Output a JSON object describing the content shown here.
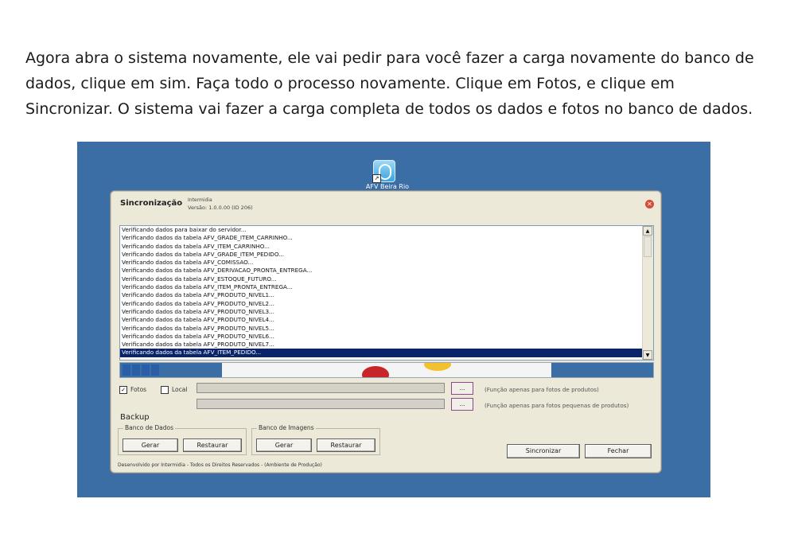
{
  "instructions": {
    "lines": [
      "Agora abra o sistema novamente, ele vai pedir para você fazer a carga novamente do banco de",
      "dados, clique em sim. Faça todo o processo novamente. Clique em Fotos, e clique em",
      "Sincronizar. O sistema vai fazer a carga completa de todos os dados e fotos no banco de dados."
    ]
  },
  "desktop": {
    "icon": "app-shortcut-icon",
    "icon_label": "AFV Beira Rio"
  },
  "dialog": {
    "title": "Sincronização",
    "company": "Intermidia",
    "version": "Versão: 1.0.0.00 (ID 206)",
    "close_icon": "close-icon",
    "log_lines": [
      "Verificando dados para baixar do servidor...",
      "Verificando dados da tabela  AFV_GRADE_ITEM_CARRINHO...",
      "Verificando dados da tabela  AFV_ITEM_CARRINHO...",
      "Verificando dados da tabela  AFV_GRADE_ITEM_PEDIDO...",
      "Verificando dados da tabela  AFV_COMISSAO...",
      "Verificando dados da tabela  AFV_DERIVACAO_PRONTA_ENTREGA...",
      "Verificando dados da tabela  AFV_ESTOQUE_FUTURO...",
      "Verificando dados da tabela  AFV_ITEM_PRONTA_ENTREGA...",
      "Verificando dados da tabela  AFV_PRODUTO_NIVEL1...",
      "Verificando dados da tabela  AFV_PRODUTO_NIVEL2...",
      "Verificando dados da tabela  AFV_PRODUTO_NIVEL3...",
      "Verificando dados da tabela  AFV_PRODUTO_NIVEL4...",
      "Verificando dados da tabela  AFV_PRODUTO_NIVEL5...",
      "Verificando dados da tabela  AFV_PRODUTO_NIVEL6...",
      "Verificando dados da tabela  AFV_PRODUTO_NIVEL7...",
      "Verificando dados da tabela  AFV_ITEM_PEDIDO..."
    ],
    "selected_line_index": 15,
    "progress_blocks": 4,
    "options": {
      "fotos_label": "Fotos",
      "fotos_checked": true,
      "fotos_check_glyph": "✓",
      "local_label": "Local",
      "local_checked": false
    },
    "path_rows": [
      {
        "button_label": "...",
        "hint": "(Função apenas para fotos de produtos)"
      },
      {
        "button_label": "...",
        "hint": "(Função apenas para fotos pequenas de produtos)"
      }
    ],
    "backup": {
      "title": "Backup",
      "database": {
        "title": "Banco de Dados",
        "generate": "Gerar",
        "restore": "Restaurar"
      },
      "images": {
        "title": "Banco de Imagens",
        "generate": "Gerar",
        "restore": "Restaurar"
      }
    },
    "actions": {
      "sync": "Sincronizar",
      "close": "Fechar"
    },
    "footer": "Desenvolvido por Intermidia - Todos os Direitos Reservados - (Ambiente de Produção)"
  },
  "colors": {
    "desktop": "#3a6ea5",
    "selection": "#0a246a",
    "progress": "#2a5fa7"
  }
}
